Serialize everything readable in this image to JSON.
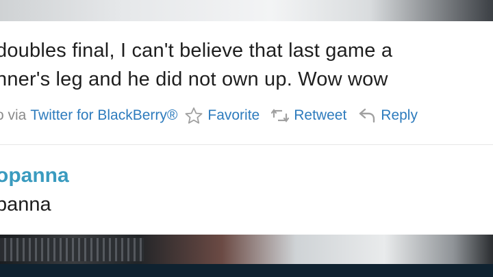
{
  "tweet": {
    "text_lines": [
      "doubles final, I can't believe that last game a",
      "nner's leg and he did not own up. Wow wow"
    ]
  },
  "meta": {
    "via_prefix": "o via",
    "client": "Twitter for BlackBerry®",
    "actions": {
      "favorite": {
        "label": "Favorite",
        "icon": "star-icon"
      },
      "retweet": {
        "label": "Retweet",
        "icon": "retweet-icon"
      },
      "reply": {
        "label": "Reply",
        "icon": "reply-arrow-icon"
      }
    }
  },
  "user": {
    "name": "opanna",
    "handle": "panna"
  },
  "colors": {
    "link": "#2d7bbd",
    "user_name": "#3a9bbf",
    "text": "#1e1e1e",
    "muted": "#999999"
  }
}
